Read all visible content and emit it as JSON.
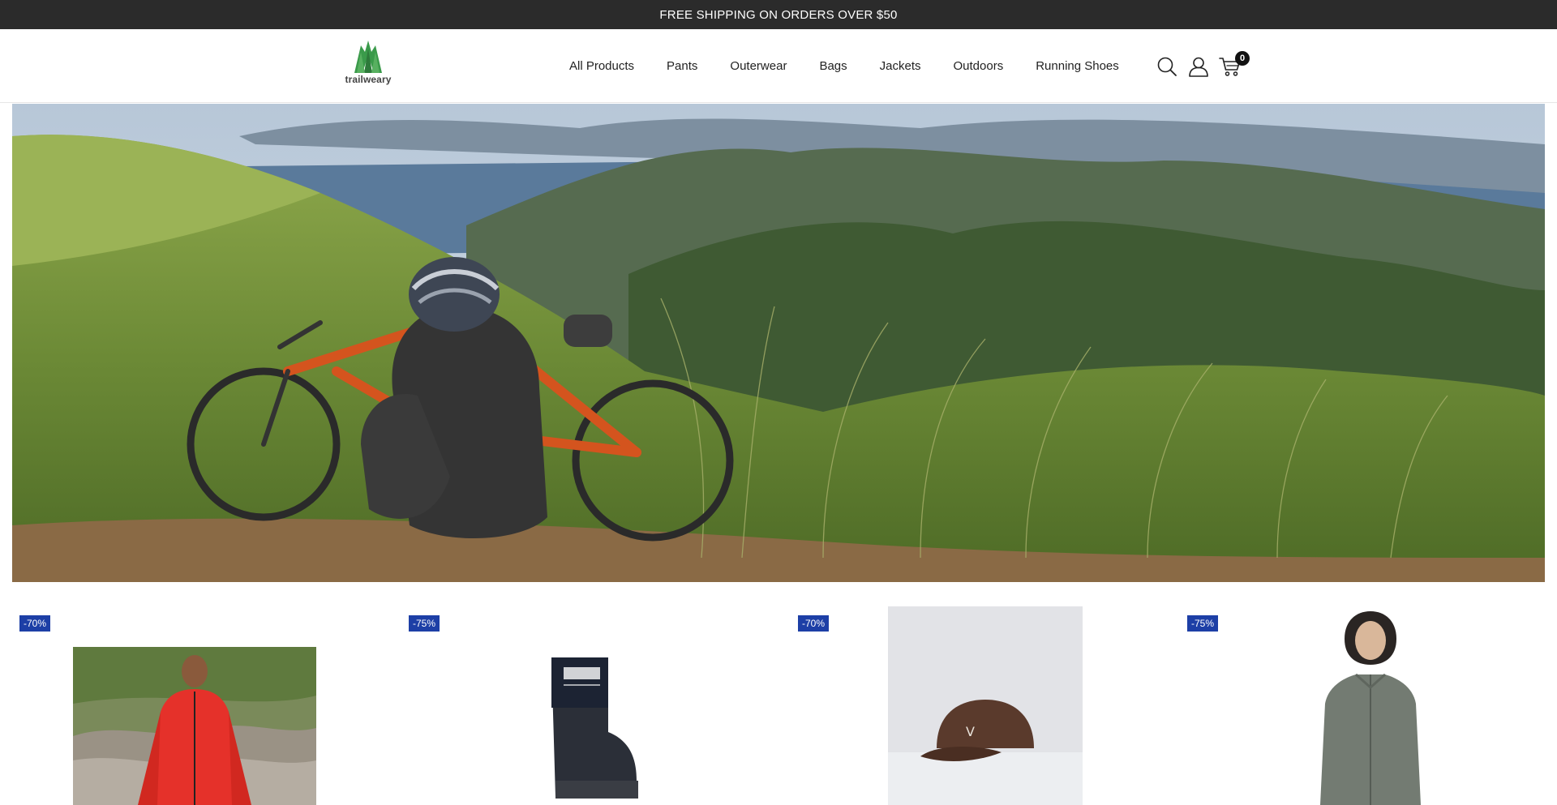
{
  "announcement": "FREE SHIPPING ON ORDERS OVER $50",
  "brand": {
    "name": "trailweary",
    "accent": "#3a9a4a"
  },
  "nav": [
    {
      "label": "All Products"
    },
    {
      "label": "Pants"
    },
    {
      "label": "Outerwear"
    },
    {
      "label": "Bags"
    },
    {
      "label": "Jackets"
    },
    {
      "label": "Outdoors"
    },
    {
      "label": "Running Shoes"
    }
  ],
  "header_icons": [
    "search-icon",
    "account-icon",
    "cart-icon"
  ],
  "cart": {
    "count": "0"
  },
  "hero": {
    "scene": "cyclist-resting-on-grassy-mountain-ridge"
  },
  "products": [
    {
      "discount": "-70%",
      "image": "man-in-red-rain-jacket"
    },
    {
      "discount": "-75%",
      "image": "black-rubber-boot"
    },
    {
      "discount": "-70%",
      "image": "brown-baseball-cap"
    },
    {
      "discount": "-75%",
      "image": "woman-in-grey-fleece-jacket"
    }
  ],
  "colors": {
    "announcement_bg": "#2b2b2b",
    "badge_bg": "#1d3fa6"
  }
}
